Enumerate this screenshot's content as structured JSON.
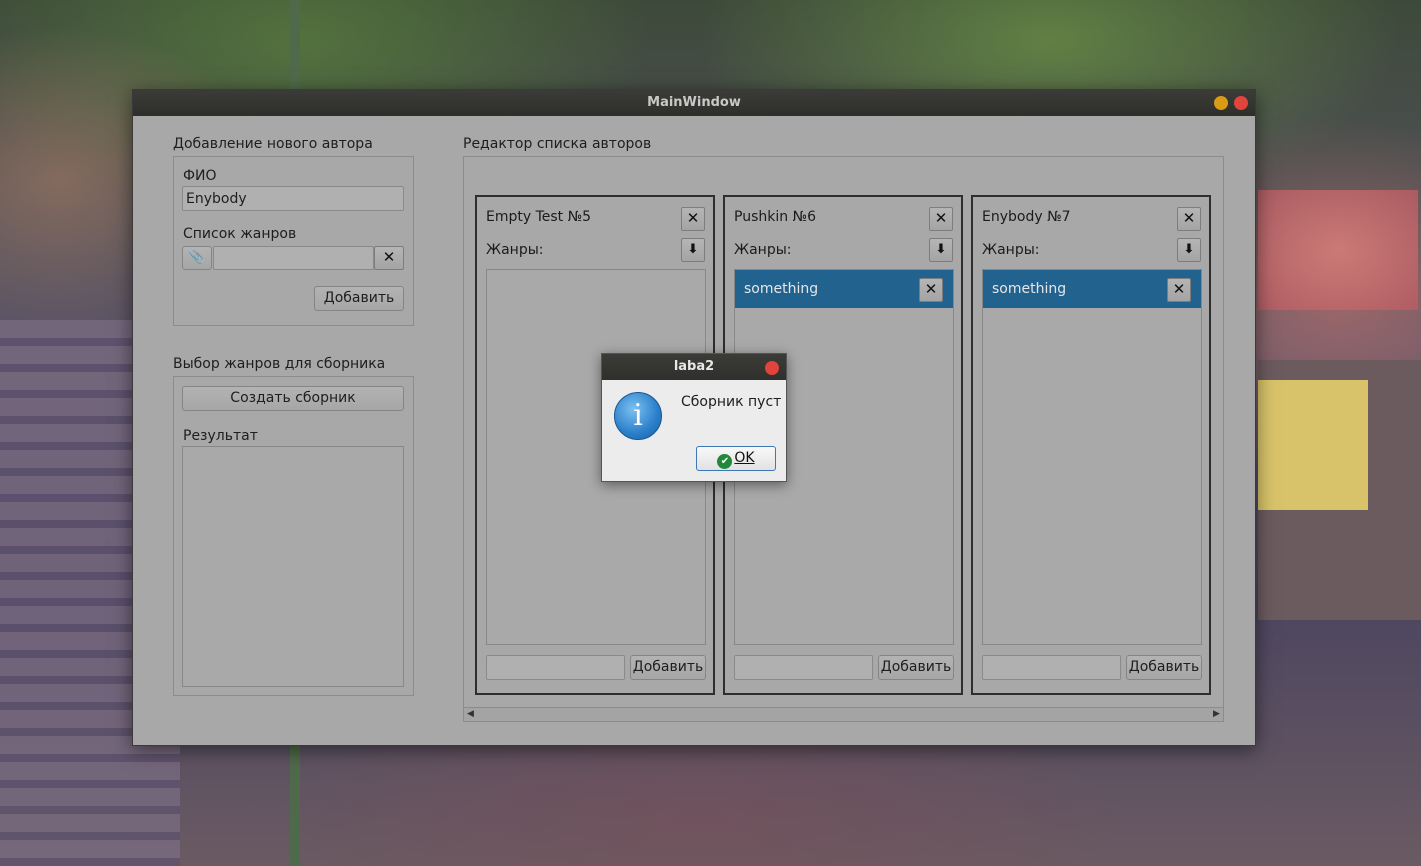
{
  "window": {
    "title": "MainWindow"
  },
  "add_author": {
    "group_title": "Добавление нового автора",
    "fio_label": "ФИО",
    "fio_value": "Enybody",
    "genres_label": "Список жанров",
    "genre_value": "",
    "clear_icon": "close-icon",
    "attach_icon": "paperclip-icon",
    "add_button": "Добавить"
  },
  "collection": {
    "group_title": "Выбор жанров для сборника",
    "create_button": "Создать сборник",
    "result_label": "Результат"
  },
  "editor": {
    "group_title": "Редактор списка авторов",
    "authors": [
      {
        "name": "Empty Test  №5",
        "genres_label": "Жанры:",
        "genres": [],
        "add_button": "Добавить",
        "new_genre_value": ""
      },
      {
        "name": "Pushkin  №6",
        "genres_label": "Жанры:",
        "genres": [
          "something"
        ],
        "add_button": "Добавить",
        "new_genre_value": ""
      },
      {
        "name": "Enybody  №7",
        "genres_label": "Жанры:",
        "genres": [
          "something"
        ],
        "add_button": "Добавить",
        "new_genre_value": ""
      }
    ]
  },
  "dialog": {
    "title": "laba2",
    "message": "Сборник пуст",
    "ok_button": "OK",
    "icon": "information-icon"
  },
  "colors": {
    "selected_genre": "#22628f",
    "window_close": "#e0443b",
    "window_minimize": "#d99a16"
  }
}
